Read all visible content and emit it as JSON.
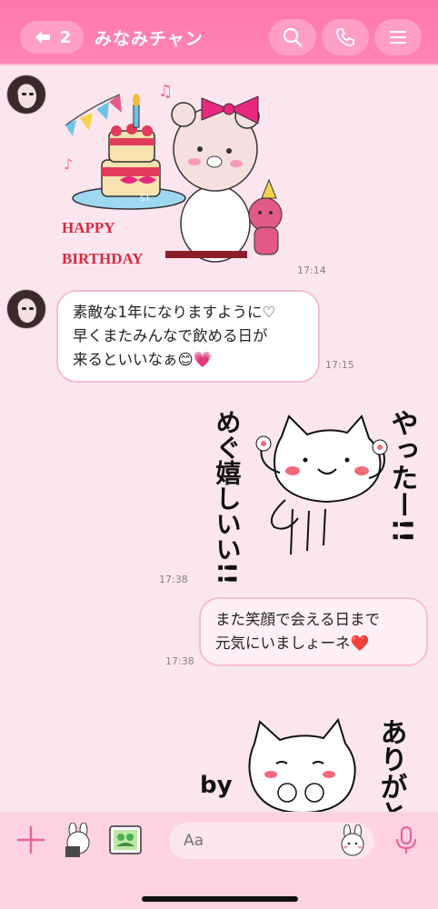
{
  "header": {
    "back_count": "2",
    "title": "みなみチャン",
    "accent_color": "#ff7aab"
  },
  "messages": [
    {
      "type": "sticker",
      "from": "other",
      "sticker_text": "HAPPY BIRTHDAY",
      "sticker_badge": "ST",
      "time": "17:14"
    },
    {
      "type": "text",
      "from": "other",
      "lines": [
        "素敵な1年になりますように♡",
        "早くまたみんなで飲める日が",
        "来るといいなぁ😊💗"
      ],
      "time": "17:15"
    },
    {
      "type": "sticker",
      "from": "me",
      "sticker_text_left": "めぐ嬉しいい!!",
      "sticker_text_right": "やったー!!",
      "time": "17:38"
    },
    {
      "type": "text",
      "from": "me",
      "lines": [
        "また笑顔で会える日まで",
        "元気にいましょーネ❤️"
      ],
      "time": "17:38"
    },
    {
      "type": "sticker",
      "from": "me",
      "sticker_text_left": "by",
      "sticker_text_right": "ありがと"
    }
  ],
  "input": {
    "placeholder": "Aa"
  },
  "icons": [
    "back-arrow-icon",
    "search-icon",
    "phone-icon",
    "menu-icon",
    "plus-icon",
    "sticker-icon",
    "photo-icon",
    "emoji-icon",
    "mic-icon"
  ]
}
